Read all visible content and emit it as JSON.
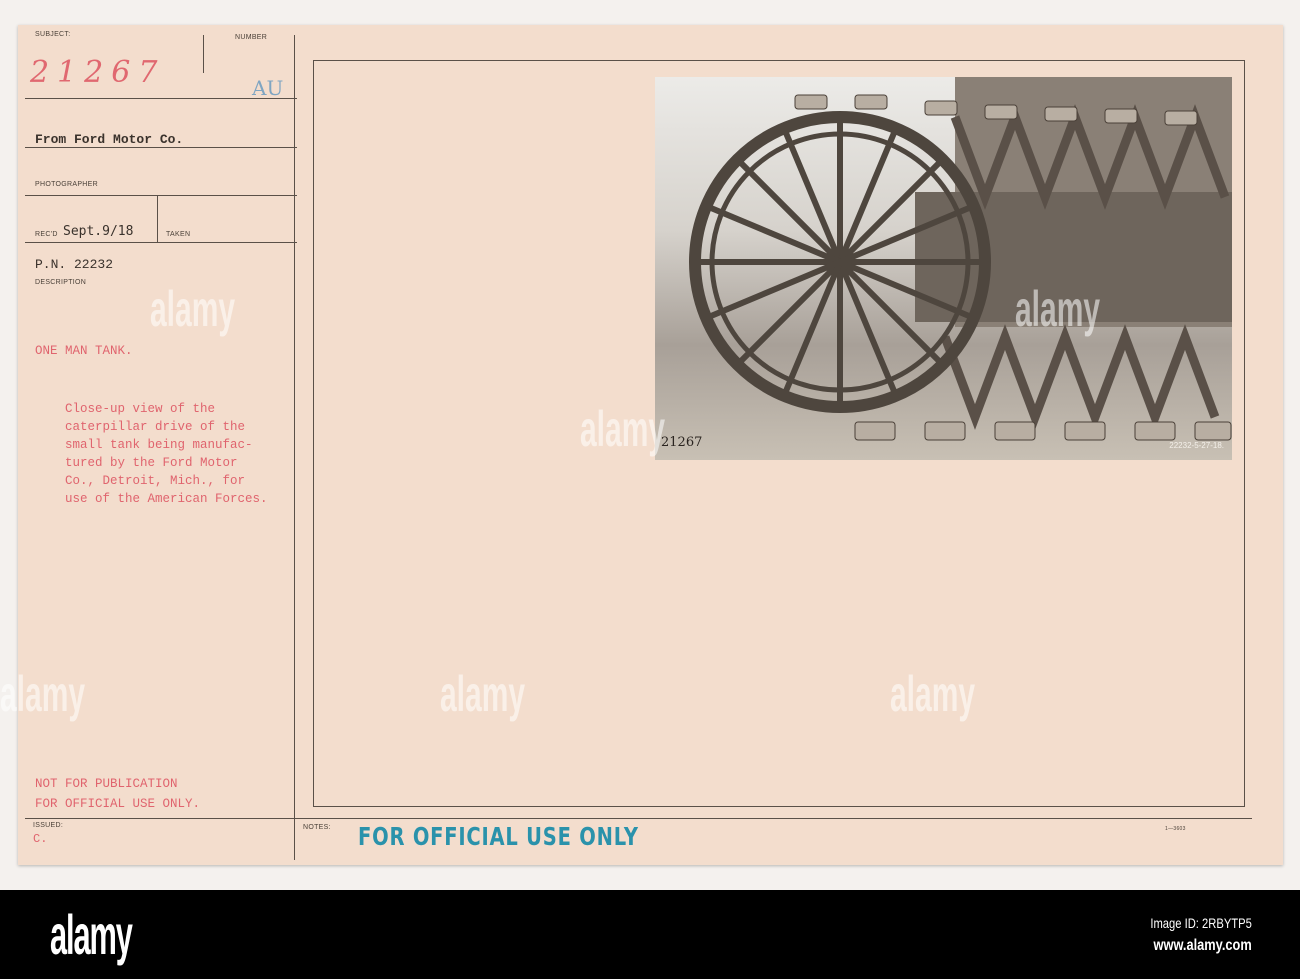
{
  "card": {
    "subject_label": "SUBJECT:",
    "subject_value": "21267",
    "number_label": "NUMBER",
    "number_value": "AU",
    "source": "From Ford Motor Co.",
    "photographer_label": "PHOTOGRAPHER",
    "recd_label": "REC'D",
    "recd_value": "Sept.9/18",
    "taken_label": "TAKEN",
    "pn": "P.N. 22232",
    "description_label": "DESCRIPTION",
    "title": "ONE MAN TANK.",
    "description": "Close-up view of the\ncaterpillar drive of the\nsmall tank being manufac-\ntured by the Ford Motor\nCo., Detroit, Mich., for\nuse of the American Forces.",
    "restriction_1": "NOT FOR PUBLICATION",
    "restriction_2": "FOR OFFICIAL USE ONLY.",
    "issued_label": "ISSUED:",
    "issued_value": "C.",
    "notes_label": "NOTES:",
    "stamp": "FOR OFFICIAL USE ONLY",
    "form_number": "1—3603"
  },
  "photo": {
    "caption_left": "21267",
    "caption_right": "22232-5-27-18."
  },
  "watermark": "alamy",
  "footer": {
    "logo": "alamy",
    "image_id": "Image ID: 2RBYTP5",
    "url": "www.alamy.com"
  }
}
